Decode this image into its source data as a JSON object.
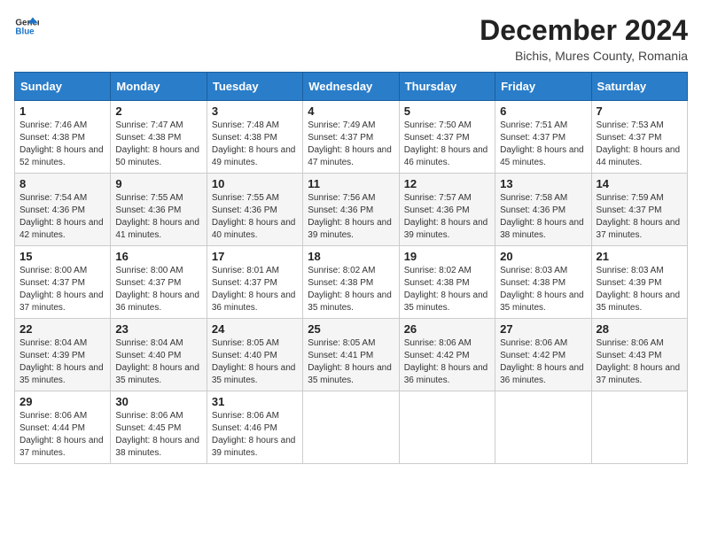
{
  "header": {
    "logo_line1": "General",
    "logo_line2": "Blue",
    "month_title": "December 2024",
    "location": "Bichis, Mures County, Romania"
  },
  "days_of_week": [
    "Sunday",
    "Monday",
    "Tuesday",
    "Wednesday",
    "Thursday",
    "Friday",
    "Saturday"
  ],
  "weeks": [
    [
      {
        "day": "1",
        "sunrise": "Sunrise: 7:46 AM",
        "sunset": "Sunset: 4:38 PM",
        "daylight": "Daylight: 8 hours and 52 minutes."
      },
      {
        "day": "2",
        "sunrise": "Sunrise: 7:47 AM",
        "sunset": "Sunset: 4:38 PM",
        "daylight": "Daylight: 8 hours and 50 minutes."
      },
      {
        "day": "3",
        "sunrise": "Sunrise: 7:48 AM",
        "sunset": "Sunset: 4:38 PM",
        "daylight": "Daylight: 8 hours and 49 minutes."
      },
      {
        "day": "4",
        "sunrise": "Sunrise: 7:49 AM",
        "sunset": "Sunset: 4:37 PM",
        "daylight": "Daylight: 8 hours and 47 minutes."
      },
      {
        "day": "5",
        "sunrise": "Sunrise: 7:50 AM",
        "sunset": "Sunset: 4:37 PM",
        "daylight": "Daylight: 8 hours and 46 minutes."
      },
      {
        "day": "6",
        "sunrise": "Sunrise: 7:51 AM",
        "sunset": "Sunset: 4:37 PM",
        "daylight": "Daylight: 8 hours and 45 minutes."
      },
      {
        "day": "7",
        "sunrise": "Sunrise: 7:53 AM",
        "sunset": "Sunset: 4:37 PM",
        "daylight": "Daylight: 8 hours and 44 minutes."
      }
    ],
    [
      {
        "day": "8",
        "sunrise": "Sunrise: 7:54 AM",
        "sunset": "Sunset: 4:36 PM",
        "daylight": "Daylight: 8 hours and 42 minutes."
      },
      {
        "day": "9",
        "sunrise": "Sunrise: 7:55 AM",
        "sunset": "Sunset: 4:36 PM",
        "daylight": "Daylight: 8 hours and 41 minutes."
      },
      {
        "day": "10",
        "sunrise": "Sunrise: 7:55 AM",
        "sunset": "Sunset: 4:36 PM",
        "daylight": "Daylight: 8 hours and 40 minutes."
      },
      {
        "day": "11",
        "sunrise": "Sunrise: 7:56 AM",
        "sunset": "Sunset: 4:36 PM",
        "daylight": "Daylight: 8 hours and 39 minutes."
      },
      {
        "day": "12",
        "sunrise": "Sunrise: 7:57 AM",
        "sunset": "Sunset: 4:36 PM",
        "daylight": "Daylight: 8 hours and 39 minutes."
      },
      {
        "day": "13",
        "sunrise": "Sunrise: 7:58 AM",
        "sunset": "Sunset: 4:36 PM",
        "daylight": "Daylight: 8 hours and 38 minutes."
      },
      {
        "day": "14",
        "sunrise": "Sunrise: 7:59 AM",
        "sunset": "Sunset: 4:37 PM",
        "daylight": "Daylight: 8 hours and 37 minutes."
      }
    ],
    [
      {
        "day": "15",
        "sunrise": "Sunrise: 8:00 AM",
        "sunset": "Sunset: 4:37 PM",
        "daylight": "Daylight: 8 hours and 37 minutes."
      },
      {
        "day": "16",
        "sunrise": "Sunrise: 8:00 AM",
        "sunset": "Sunset: 4:37 PM",
        "daylight": "Daylight: 8 hours and 36 minutes."
      },
      {
        "day": "17",
        "sunrise": "Sunrise: 8:01 AM",
        "sunset": "Sunset: 4:37 PM",
        "daylight": "Daylight: 8 hours and 36 minutes."
      },
      {
        "day": "18",
        "sunrise": "Sunrise: 8:02 AM",
        "sunset": "Sunset: 4:38 PM",
        "daylight": "Daylight: 8 hours and 35 minutes."
      },
      {
        "day": "19",
        "sunrise": "Sunrise: 8:02 AM",
        "sunset": "Sunset: 4:38 PM",
        "daylight": "Daylight: 8 hours and 35 minutes."
      },
      {
        "day": "20",
        "sunrise": "Sunrise: 8:03 AM",
        "sunset": "Sunset: 4:38 PM",
        "daylight": "Daylight: 8 hours and 35 minutes."
      },
      {
        "day": "21",
        "sunrise": "Sunrise: 8:03 AM",
        "sunset": "Sunset: 4:39 PM",
        "daylight": "Daylight: 8 hours and 35 minutes."
      }
    ],
    [
      {
        "day": "22",
        "sunrise": "Sunrise: 8:04 AM",
        "sunset": "Sunset: 4:39 PM",
        "daylight": "Daylight: 8 hours and 35 minutes."
      },
      {
        "day": "23",
        "sunrise": "Sunrise: 8:04 AM",
        "sunset": "Sunset: 4:40 PM",
        "daylight": "Daylight: 8 hours and 35 minutes."
      },
      {
        "day": "24",
        "sunrise": "Sunrise: 8:05 AM",
        "sunset": "Sunset: 4:40 PM",
        "daylight": "Daylight: 8 hours and 35 minutes."
      },
      {
        "day": "25",
        "sunrise": "Sunrise: 8:05 AM",
        "sunset": "Sunset: 4:41 PM",
        "daylight": "Daylight: 8 hours and 35 minutes."
      },
      {
        "day": "26",
        "sunrise": "Sunrise: 8:06 AM",
        "sunset": "Sunset: 4:42 PM",
        "daylight": "Daylight: 8 hours and 36 minutes."
      },
      {
        "day": "27",
        "sunrise": "Sunrise: 8:06 AM",
        "sunset": "Sunset: 4:42 PM",
        "daylight": "Daylight: 8 hours and 36 minutes."
      },
      {
        "day": "28",
        "sunrise": "Sunrise: 8:06 AM",
        "sunset": "Sunset: 4:43 PM",
        "daylight": "Daylight: 8 hours and 37 minutes."
      }
    ],
    [
      {
        "day": "29",
        "sunrise": "Sunrise: 8:06 AM",
        "sunset": "Sunset: 4:44 PM",
        "daylight": "Daylight: 8 hours and 37 minutes."
      },
      {
        "day": "30",
        "sunrise": "Sunrise: 8:06 AM",
        "sunset": "Sunset: 4:45 PM",
        "daylight": "Daylight: 8 hours and 38 minutes."
      },
      {
        "day": "31",
        "sunrise": "Sunrise: 8:06 AM",
        "sunset": "Sunset: 4:46 PM",
        "daylight": "Daylight: 8 hours and 39 minutes."
      },
      null,
      null,
      null,
      null
    ]
  ]
}
